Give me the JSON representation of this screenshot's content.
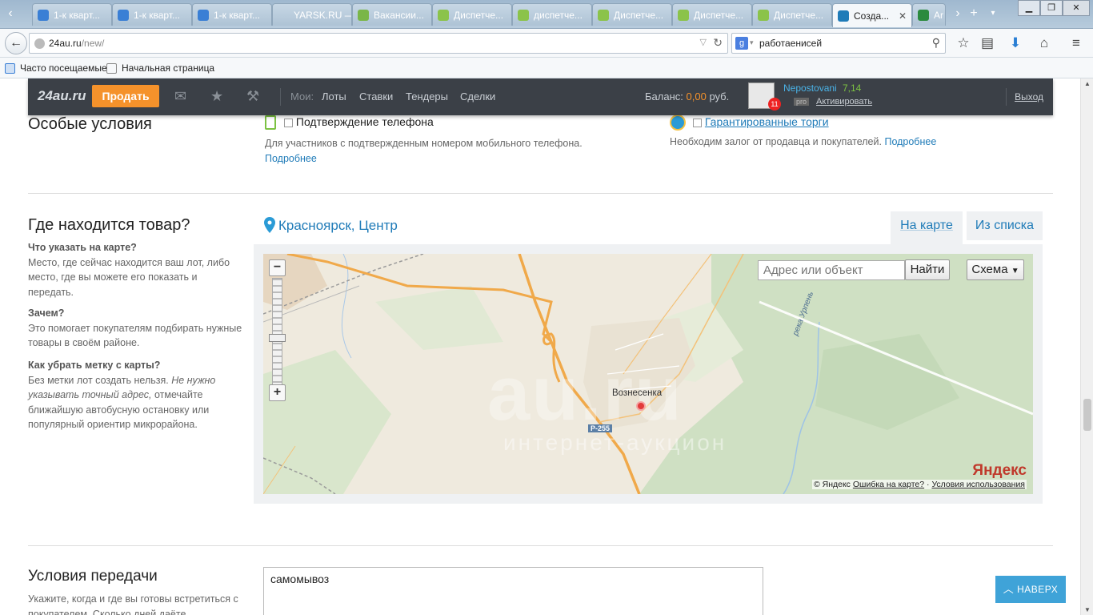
{
  "browser": {
    "tabs": [
      {
        "label": "1-к кварт...",
        "icon_color": "#3a7fd5"
      },
      {
        "label": "1-к кварт...",
        "icon_color": "#3a7fd5"
      },
      {
        "label": "1-к кварт...",
        "icon_color": "#3a7fd5"
      },
      {
        "label": "YARSK.RU — Л...",
        "icon_color": ""
      },
      {
        "label": "Вакансии...",
        "icon_color": "#7ab648"
      },
      {
        "label": "Диспетче...",
        "icon_color": "#8bc34a"
      },
      {
        "label": "диспетче...",
        "icon_color": "#8bc34a"
      },
      {
        "label": "Диспетче...",
        "icon_color": "#8bc34a"
      },
      {
        "label": "Диспетче...",
        "icon_color": "#8bc34a"
      },
      {
        "label": "Диспетче...",
        "icon_color": "#8bc34a"
      },
      {
        "label": "Созда...",
        "icon_color": "#1f7bb8",
        "active": true
      },
      {
        "label": "Ar",
        "icon_color": "#2b8a3e"
      }
    ],
    "url_host": "24au.ru",
    "url_path": "/new/",
    "search_value": "работаенисей",
    "bookmarks": [
      "Часто посещаемые",
      "Начальная страница"
    ]
  },
  "site_header": {
    "logo": "24au.ru",
    "sell_label": "Продать",
    "my_label": "Мои:",
    "links": [
      "Лоты",
      "Ставки",
      "Тендеры",
      "Сделки"
    ],
    "balance_label": "Баланс:",
    "balance_amount": "0,00",
    "balance_currency": "руб.",
    "username": "Nepostovani",
    "rating": "7,14",
    "notifications": "11",
    "pro_label": "pro",
    "activate_label": "Активировать",
    "logout_label": "Выход"
  },
  "special_conditions": {
    "title": "Особые условия",
    "phone_label": "Подтверждение телефона",
    "phone_desc": "Для участников с подтвержденным номером мобильного телефона.",
    "phone_more": "Подробнее",
    "guarantee_label": "Гарантированные торги",
    "guarantee_desc": "Необходим залог от продавца и покупателей.",
    "guarantee_more": "Подробнее"
  },
  "location": {
    "title": "Где находится товар?",
    "q1_title": "Что указать на карте?",
    "q1_text": "Место, где сейчас находится ваш лот, либо место, где вы можете его показать и передать.",
    "q2_title": "Зачем?",
    "q2_text": "Это помогает покупателям подбирать нужные товары в своём районе.",
    "q3_title": "Как убрать метку с карты?",
    "q3_text_a": "Без метки лот создать нельзя.",
    "q3_text_b": "Не нужно указывать точный адрес,",
    "q3_text_c": "отмечайте ближайшую автобусную остановку или популярный ориентир микрорайона.",
    "city": "Красноярск, Центр",
    "tab_map": "На карте",
    "tab_list": "Из списка",
    "map": {
      "search_placeholder": "Адрес или объект",
      "find_label": "Найти",
      "scheme_label": "Схема",
      "village": "Вознесенка",
      "road": "Р-255",
      "river": "река Урпень",
      "watermark": "au.ru",
      "watermark_sub": "интернет-аукцион",
      "yandex_logo": "Яндекс",
      "copyright": "© Яндекс",
      "error_link": "Ошибка на карте?",
      "terms_link": "Условия использования"
    }
  },
  "delivery": {
    "title": "Условия передачи",
    "desc": "Укажите, когда и где вы готовы встретиться с покупателем. Сколько дней даёте",
    "value": "самомывоз"
  },
  "up_button": "НАВЕРХ"
}
